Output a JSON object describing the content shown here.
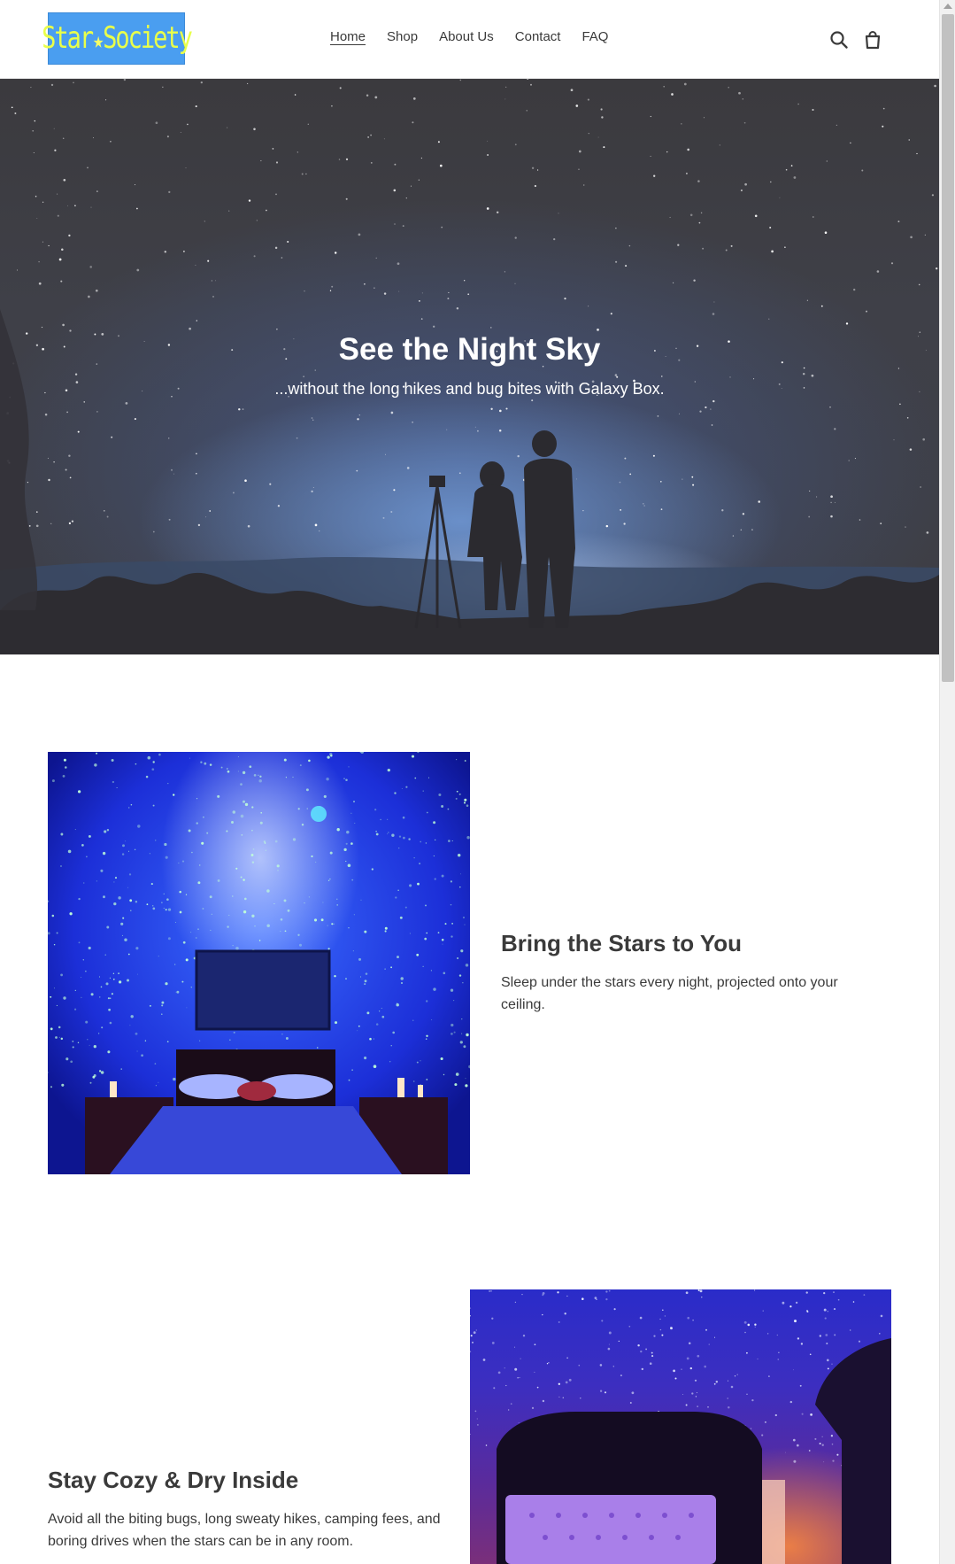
{
  "header": {
    "logo": {
      "text_left": "Star",
      "text_right": "Society",
      "bg_color": "#4a9ef0",
      "text_color": "#e9ff4a"
    },
    "nav": [
      {
        "label": "Home",
        "active": true
      },
      {
        "label": "Shop",
        "active": false
      },
      {
        "label": "About Us",
        "active": false
      },
      {
        "label": "Contact",
        "active": false
      },
      {
        "label": "FAQ",
        "active": false
      }
    ],
    "icons": {
      "search": "search-icon",
      "cart": "cart-icon"
    }
  },
  "hero": {
    "title": "See the Night Sky",
    "subtitle": "...without the long hikes and bug bites with Galaxy Box."
  },
  "features": [
    {
      "heading": "Bring the Stars to You",
      "body": "Sleep under the stars every night, projected onto your ceiling."
    },
    {
      "heading": "Stay Cozy & Dry Inside",
      "body": "Avoid all the biting bugs, long sweaty hikes, camping fees, and boring drives when the stars can be in any room."
    }
  ]
}
